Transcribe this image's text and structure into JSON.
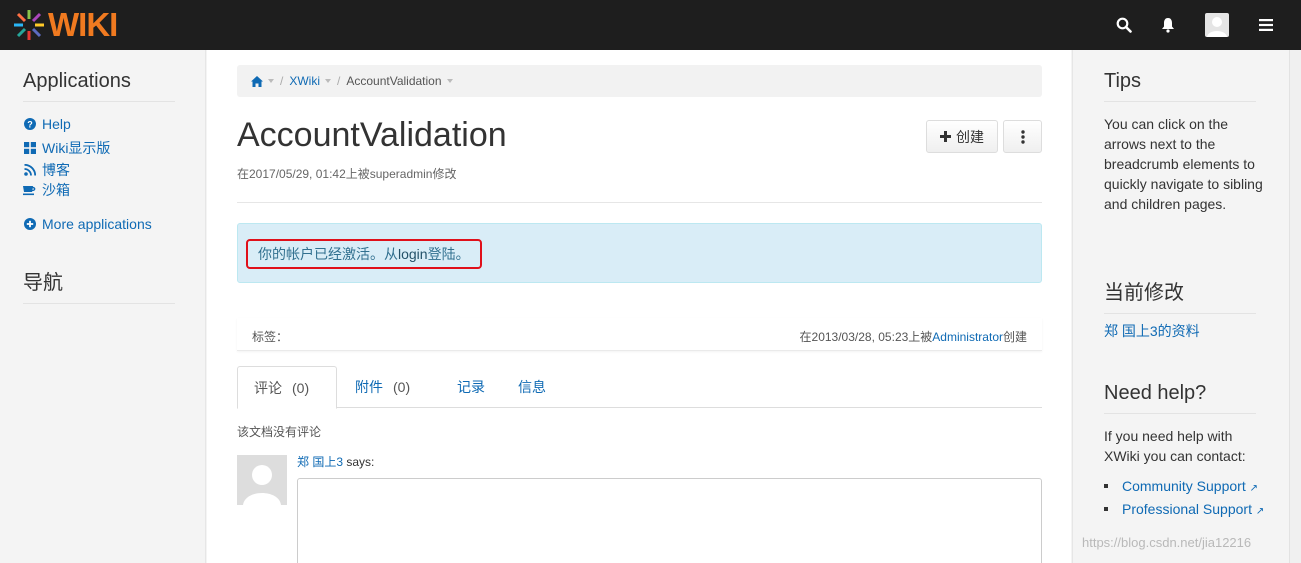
{
  "header": {
    "logo_text": "WIKI",
    "colors": {
      "bar": "#1e1e1e",
      "logo": "#f07a20"
    },
    "icons": [
      "search-icon",
      "bell-icon",
      "user-avatar",
      "hamburger-menu-icon"
    ]
  },
  "left_panel": {
    "applications_title": "Applications",
    "apps": [
      {
        "label": "Help",
        "icon": "question-circle-icon"
      },
      {
        "label": "Wiki显示版",
        "icon": "grid-icon"
      },
      {
        "label": "博客",
        "icon": "rss-icon"
      },
      {
        "label": "沙箱",
        "icon": "coffee-icon"
      }
    ],
    "more_apps": "More applications",
    "nav_title": "导航"
  },
  "breadcrumb": {
    "items": [
      "XWiki",
      "AccountValidation"
    ]
  },
  "page": {
    "title": "AccountValidation",
    "modified": "在2017/05/29, 01:42上被superadmin修改",
    "create_button": "创建",
    "info_message_prefix": "你的帐户已经激活。从",
    "info_message_link": "login",
    "info_message_suffix": "登陆。",
    "tags_label": "标签：",
    "created_prefix": "在2013/03/28, 05:23上被",
    "created_user": "Administrator",
    "created_suffix": "创建"
  },
  "tabs": [
    {
      "label": "评论",
      "count": "(0)",
      "active": true
    },
    {
      "label": "附件",
      "count": "(0)",
      "active": false
    },
    {
      "label": "记录",
      "count": "",
      "active": false
    },
    {
      "label": "信息",
      "count": "",
      "active": false
    }
  ],
  "comments": {
    "empty_text": "该文档没有评论",
    "user": "郑 国上3",
    "says": "says:"
  },
  "right_panel": {
    "tips_title": "Tips",
    "tips_text": "You can click on the arrows next to the breadcrumb elements to quickly navigate to sibling and children pages.",
    "recent_title": "当前修改",
    "recent_item": "郑 国上3的资料",
    "help_title": "Need help?",
    "help_text": "If you need help with XWiki you can contact:",
    "help_links": [
      "Community Support",
      "Professional Support"
    ]
  },
  "watermark": "https://blog.csdn.net/jia12216"
}
